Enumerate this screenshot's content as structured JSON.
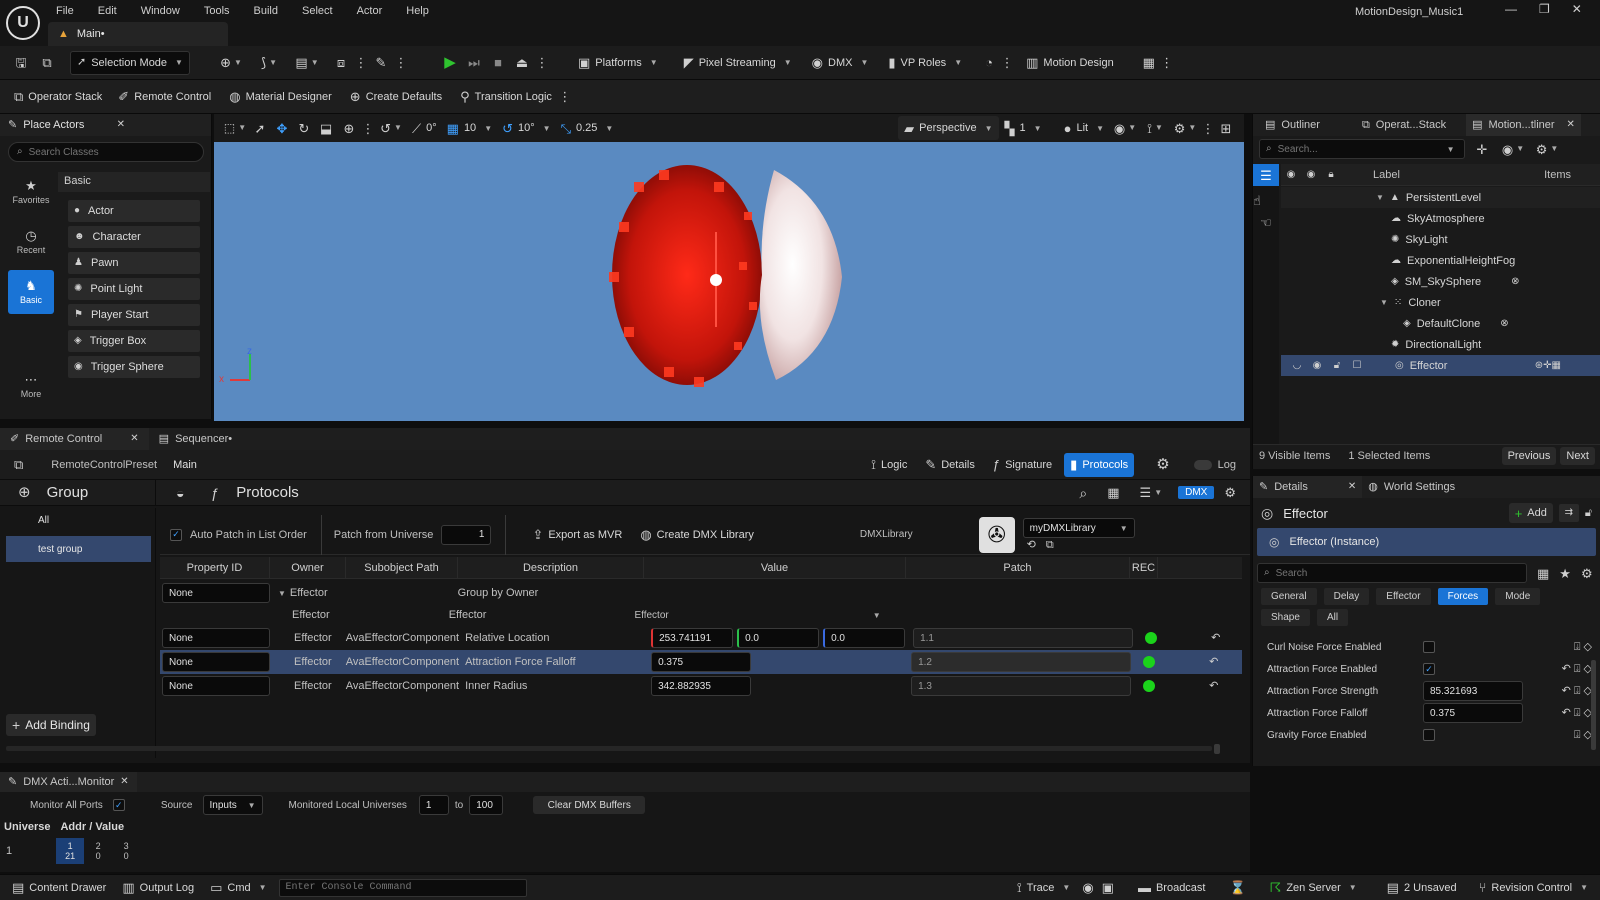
{
  "window": {
    "title": "MotionDesign_Music1",
    "tab": "Main•"
  },
  "menu": [
    "File",
    "Edit",
    "Window",
    "Tools",
    "Build",
    "Select",
    "Actor",
    "Help"
  ],
  "toolbar": {
    "selection_mode": "Selection Mode",
    "platforms": "Platforms",
    "pixel_streaming": "Pixel Streaming",
    "dmx": "DMX",
    "vp_roles": "VP Roles",
    "motion_design": "Motion Design"
  },
  "secondbar": [
    "Operator Stack",
    "Remote Control",
    "Material Designer",
    "Create Defaults",
    "Transition Logic"
  ],
  "place_actors": {
    "tab": "Place Actors",
    "search_placeholder": "Search Classes",
    "side": [
      "Favorites",
      "Recent",
      "Basic",
      "More"
    ],
    "category": "Basic",
    "items": [
      "Actor",
      "Character",
      "Pawn",
      "Point Light",
      "Player Start",
      "Trigger Box",
      "Trigger Sphere"
    ]
  },
  "viewport": {
    "snap_rotate": "0°",
    "grid": "10",
    "angle": "10°",
    "scale": "0.25",
    "perspective": "Perspective",
    "cam": "1",
    "lit": "Lit",
    "axis_x": "x",
    "axis_z": "z"
  },
  "outliner": {
    "tabs": [
      "Outliner",
      "Operat...Stack",
      "Motion...tliner"
    ],
    "search_placeholder": "Search...",
    "col_label": "Label",
    "col_items": "Items",
    "rows": [
      "PersistentLevel",
      "SkyAtmosphere",
      "SkyLight",
      "ExponentialHeightFog",
      "SM_SkySphere",
      "Cloner",
      "DefaultClone",
      "DirectionalLight",
      "Effector"
    ],
    "visible": "9 Visible Items",
    "selected": "1 Selected Items",
    "prev": "Previous",
    "next": "Next"
  },
  "rc": {
    "tabs": [
      "Remote Control",
      "Sequencer•"
    ],
    "preset": "RemoteControlPreset",
    "preset_main": "Main",
    "modes": [
      "Logic",
      "Details",
      "Signature",
      "Protocols"
    ],
    "log": "Log",
    "group_title": "Group",
    "groups": [
      "All",
      "test group"
    ],
    "protocols_title": "Protocols",
    "dmx_badge": "DMX",
    "auto_patch": "Auto Patch in List Order",
    "patch_from": "Patch from Universe",
    "patch_value": "1",
    "export_mvr": "Export as MVR",
    "create_lib": "Create DMX Library",
    "dmx_library_label": "DMXLibrary",
    "dmx_library_value": "myDMXLibrary",
    "columns": [
      "Property ID",
      "Owner",
      "Subobject Path",
      "Description",
      "Value",
      "Patch",
      "REC"
    ],
    "group_row": {
      "id": "None",
      "owner": "Effector",
      "desc": "Group by Owner"
    },
    "sub_row": {
      "owner": "Effector",
      "desc": "Effector",
      "value": "Effector"
    },
    "rows": [
      {
        "id": "None",
        "owner": "Effector",
        "path": "AvaEffectorComponent",
        "desc": "Relative Location",
        "v1": "253.741191",
        "v2": "0.0",
        "v3": "0.0",
        "patch": "1.1"
      },
      {
        "id": "None",
        "owner": "Effector",
        "path": "AvaEffectorComponent",
        "desc": "Attraction Force Falloff",
        "v1": "0.375",
        "patch": "1.2"
      },
      {
        "id": "None",
        "owner": "Effector",
        "path": "AvaEffectorComponent",
        "desc": "Inner Radius",
        "v1": "342.882935",
        "patch": "1.3"
      }
    ],
    "add_binding": "Add Binding"
  },
  "details": {
    "tabs": [
      "Details",
      "World Settings"
    ],
    "actor": "Effector",
    "add": "Add",
    "instance": "Effector (Instance)",
    "search_placeholder": "Search",
    "filters_row1": [
      "General",
      "Delay",
      "Effector",
      "Forces",
      "Mode"
    ],
    "filters_row2": [
      "Shape",
      "All"
    ],
    "props": [
      {
        "label": "Curl Noise Force Enabled",
        "type": "check",
        "checked": false
      },
      {
        "label": "Attraction Force Enabled",
        "type": "check",
        "checked": true
      },
      {
        "label": "Attraction Force Strength",
        "type": "value",
        "value": "85.321693"
      },
      {
        "label": "Attraction Force Falloff",
        "type": "value",
        "value": "0.375"
      },
      {
        "label": "Gravity Force Enabled",
        "type": "check",
        "checked": false
      }
    ]
  },
  "dmx": {
    "tab": "DMX Acti...Monitor",
    "monitor_all": "Monitor All Ports",
    "source_label": "Source",
    "source_value": "Inputs",
    "universes_label": "Monitored Local Universes",
    "from": "1",
    "to_label": "to",
    "to": "100",
    "clear": "Clear DMX Buffers",
    "col_universe": "Universe",
    "col_addr": "Addr / Value",
    "universe": "1",
    "addrs": [
      "1",
      "2",
      "3"
    ],
    "values": [
      "21",
      "0",
      "0"
    ]
  },
  "status": {
    "content_drawer": "Content Drawer",
    "output_log": "Output Log",
    "cmd": "Cmd",
    "console_placeholder": "Enter Console Command",
    "trace": "Trace",
    "broadcast": "Broadcast",
    "zen": "Zen Server",
    "unsaved": "2 Unsaved",
    "revision": "Revision Control"
  },
  "colors": {
    "accent": "#1a74d6",
    "selected_row": "#34486e",
    "status_ok": "#1bd31b"
  }
}
